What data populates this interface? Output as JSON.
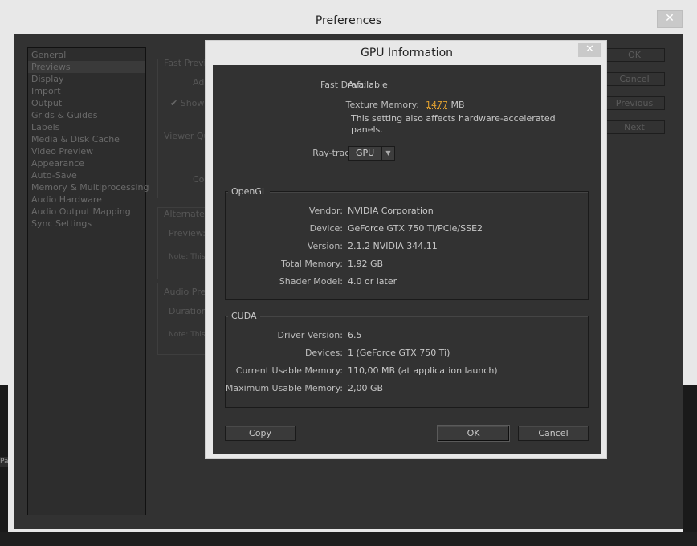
{
  "preferences": {
    "title": "Preferences",
    "close": "✕",
    "sidebar": [
      "General",
      "Previews",
      "Display",
      "Import",
      "Output",
      "Grids & Guides",
      "Labels",
      "Media & Disk Cache",
      "Video Preview",
      "Appearance",
      "Auto-Save",
      "Memory & Multiprocessing",
      "Audio Hardware",
      "Audio Output Mapping",
      "Sync Settings"
    ],
    "selected_index": 1,
    "buttons": {
      "ok": "OK",
      "cancel": "Cancel",
      "previous": "Previous",
      "next": "Next"
    },
    "groups": {
      "fast_previews": "Fast Previ",
      "fast_previews_add": "Ad",
      "fast_previews_show": "Show",
      "viewer_quality": "Viewer Qu",
      "viewer_col": "Co",
      "alternate": "Alternate",
      "alternate_preview": "Preview:",
      "alternate_note": "Note: This",
      "audio_preview": "Audio Prev",
      "audio_duration": "Duration",
      "audio_note": "Note: This"
    }
  },
  "gpu": {
    "title": "GPU Information",
    "close": "✕",
    "fast_draft_label": "Fast Draft:",
    "fast_draft_value": "Available",
    "texture_memory_label": "Texture Memory:",
    "texture_memory_value": "1477",
    "texture_memory_unit": "MB",
    "note_line1": "This setting also affects hardware-accelerated",
    "note_line2": "panels.",
    "raytracing_label": "Ray-tracing:",
    "raytracing_value": "GPU",
    "opengl": {
      "title": "OpenGL",
      "rows": [
        {
          "label": "Vendor:",
          "value": "NVIDIA Corporation"
        },
        {
          "label": "Device:",
          "value": "GeForce GTX 750 Ti/PCIe/SSE2"
        },
        {
          "label": "Version:",
          "value": "2.1.2 NVIDIA 344.11"
        },
        {
          "label": "Total Memory:",
          "value": "1,92 GB"
        },
        {
          "label": "Shader Model:",
          "value": "4.0 or later"
        }
      ]
    },
    "cuda": {
      "title": "CUDA",
      "rows": [
        {
          "label": "Driver Version:",
          "value": "6.5"
        },
        {
          "label": "Devices:",
          "value": "1 (GeForce GTX 750 Ti)"
        },
        {
          "label": "Current Usable Memory:",
          "value": "110,00 MB (at application launch)"
        },
        {
          "label": "Maximum Usable Memory:",
          "value": "2,00 GB"
        }
      ]
    },
    "buttons": {
      "copy": "Copy",
      "ok": "OK",
      "cancel": "Cancel"
    }
  },
  "background_fragment": "Pa"
}
